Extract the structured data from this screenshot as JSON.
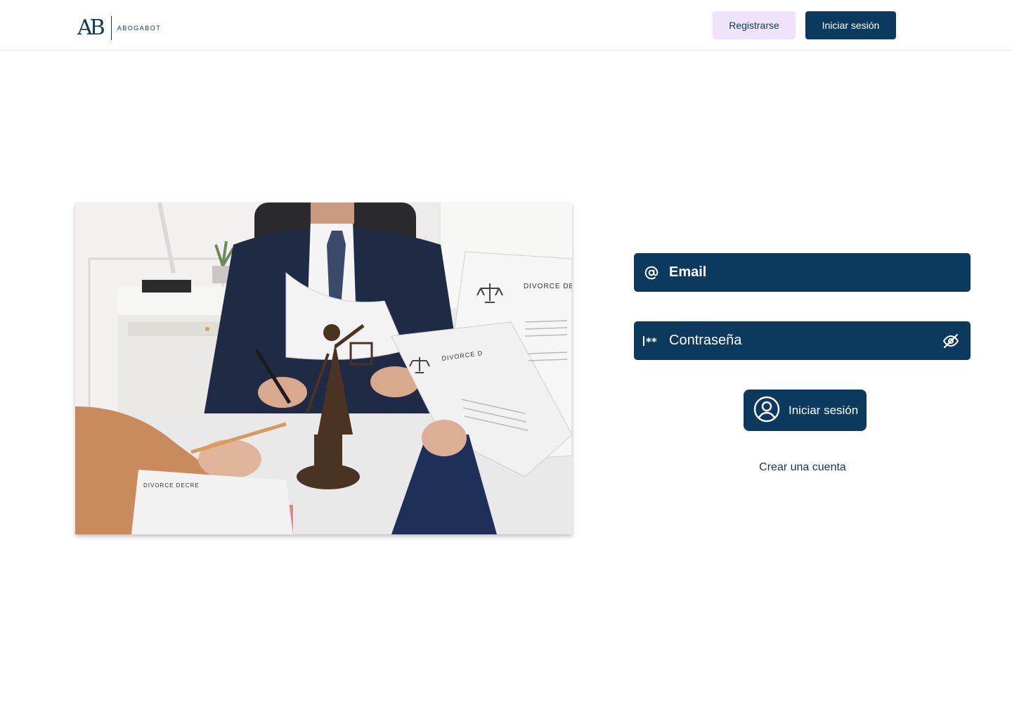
{
  "header": {
    "logo": {
      "mark": "AB",
      "name": "ABOGABOT"
    },
    "register_label": "Registrarse",
    "login_label": "Iniciar sesión"
  },
  "hero": {
    "document_labels": [
      "DIVORCE DE",
      "DIVORCE D",
      "DIVORCE DECRE"
    ]
  },
  "form": {
    "email": {
      "placeholder": "Email",
      "icon": "at-icon"
    },
    "password": {
      "placeholder": "Contraseña",
      "icon": "password-mask-icon",
      "toggle_icon": "eye-off-icon"
    },
    "submit_label": "Iniciar sesión",
    "submit_icon": "user-circle-icon",
    "create_account_label": "Crear una cuenta"
  },
  "colors": {
    "primary": "#0b3a5e",
    "register_bg": "#efe3fb",
    "background": "#ffffff"
  }
}
